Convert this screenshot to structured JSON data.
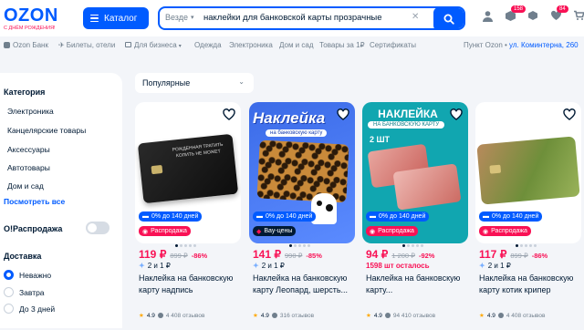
{
  "header": {
    "logo": "OZON",
    "logo_sub": "С ДНЁМ РОЖДЕНИЯ!",
    "catalog_label": "Каталог",
    "search": {
      "scope": "Везде",
      "query": "наклейки для банковской карты прозрачные"
    },
    "badges": {
      "orders": "158",
      "favorites": "84"
    },
    "accent": "#005bff",
    "sale_color": "#f91155"
  },
  "nav": {
    "links": [
      "Ozon Банк",
      "Билеты, отели",
      "Для бизнеса",
      "Одежда",
      "Электроника",
      "Дом и сад",
      "Товары за 1₽",
      "Сертификаты"
    ],
    "pickup_label": "Пункт Ozon •",
    "pickup_address": "ул. Коминтерна, 260"
  },
  "sidebar": {
    "category_title": "Категория",
    "categories": [
      "Электроника",
      "Канцелярские товары",
      "Аксессуары",
      "Автотовары",
      "Дом и сад"
    ],
    "see_all": "Посмотреть все",
    "sale_toggle_label": "О!Распродажа",
    "delivery_title": "Доставка",
    "delivery_options": [
      "Неважно",
      "Завтра",
      "До 3 дней"
    ],
    "delivery_selected": 0
  },
  "sort": {
    "label": "Популярные"
  },
  "cards": [
    {
      "installment": "0% до 140 дней",
      "tag": "Распродажа",
      "price": "119 ₽",
      "old_price": "899 ₽",
      "discount": "-86%",
      "second_line": "2 и 1 ₽",
      "title": "Наклейка на банковскую карту надпись",
      "rating": "4.9",
      "reviews": "4 408 отзывов",
      "image_text": "РОЖДЕННАЯ ТРАТИТЬ КОПИТЬ НЕ МОЖЕТ"
    },
    {
      "installment": "0% до 140 дней",
      "tag": "Вау-цены",
      "price": "141 ₽",
      "old_price": "990 ₽",
      "discount": "-85%",
      "second_line": "2 и 1 ₽",
      "title": "Наклейка на банковскую карту Леопард, шерсть...",
      "rating": "4.9",
      "reviews": "316 отзывов",
      "image_text": "Наклейка",
      "image_sub": "на банковскую карту"
    },
    {
      "installment": "0% до 140 дней",
      "tag": "Распродажа",
      "price": "94 ₽",
      "old_price": "1 200 ₽",
      "discount": "-92%",
      "second_line": "1598 шт осталось",
      "title": "Наклейка на банковскую карту...",
      "rating": "4.9",
      "reviews": "94 410 отзывов",
      "image_text": "НАКЛЕЙКА",
      "image_sub": "НА БАНКОВСКУЮ КАРТУ",
      "image_badge": "2 ШТ"
    },
    {
      "installment": "0% до 140 дней",
      "tag": "Распродажа",
      "price": "117 ₽",
      "old_price": "899 ₽",
      "discount": "-86%",
      "second_line": "2 и 1 ₽",
      "title": "Наклейка на банковскую карту котик крипер",
      "rating": "4.9",
      "reviews": "4 408 отзывов"
    }
  ]
}
